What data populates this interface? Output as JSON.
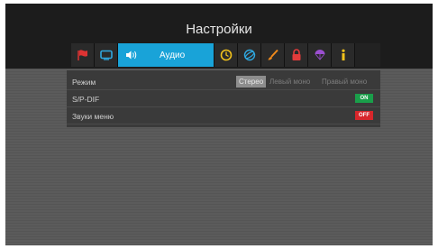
{
  "title": "Настройки",
  "tabs": {
    "active_label": "Аудио",
    "icons": [
      "flag-icon",
      "screen-icon",
      "speaker-icon",
      "clock-icon",
      "globe-icon",
      "brush-icon",
      "lock-icon",
      "parachute-icon",
      "info-icon"
    ]
  },
  "rows": {
    "mode": {
      "label": "Режим",
      "options": [
        "Стерео",
        "Левый моно",
        "Правый моно"
      ],
      "selected": "Стерео"
    },
    "spdif": {
      "label": "S/P-DIF",
      "value": "ON"
    },
    "menu_sounds": {
      "label": "Звуки меню",
      "value": "OFF"
    }
  },
  "colors": {
    "accent": "#19a3d8",
    "on": "#1a9e4a",
    "off": "#d7262b"
  }
}
